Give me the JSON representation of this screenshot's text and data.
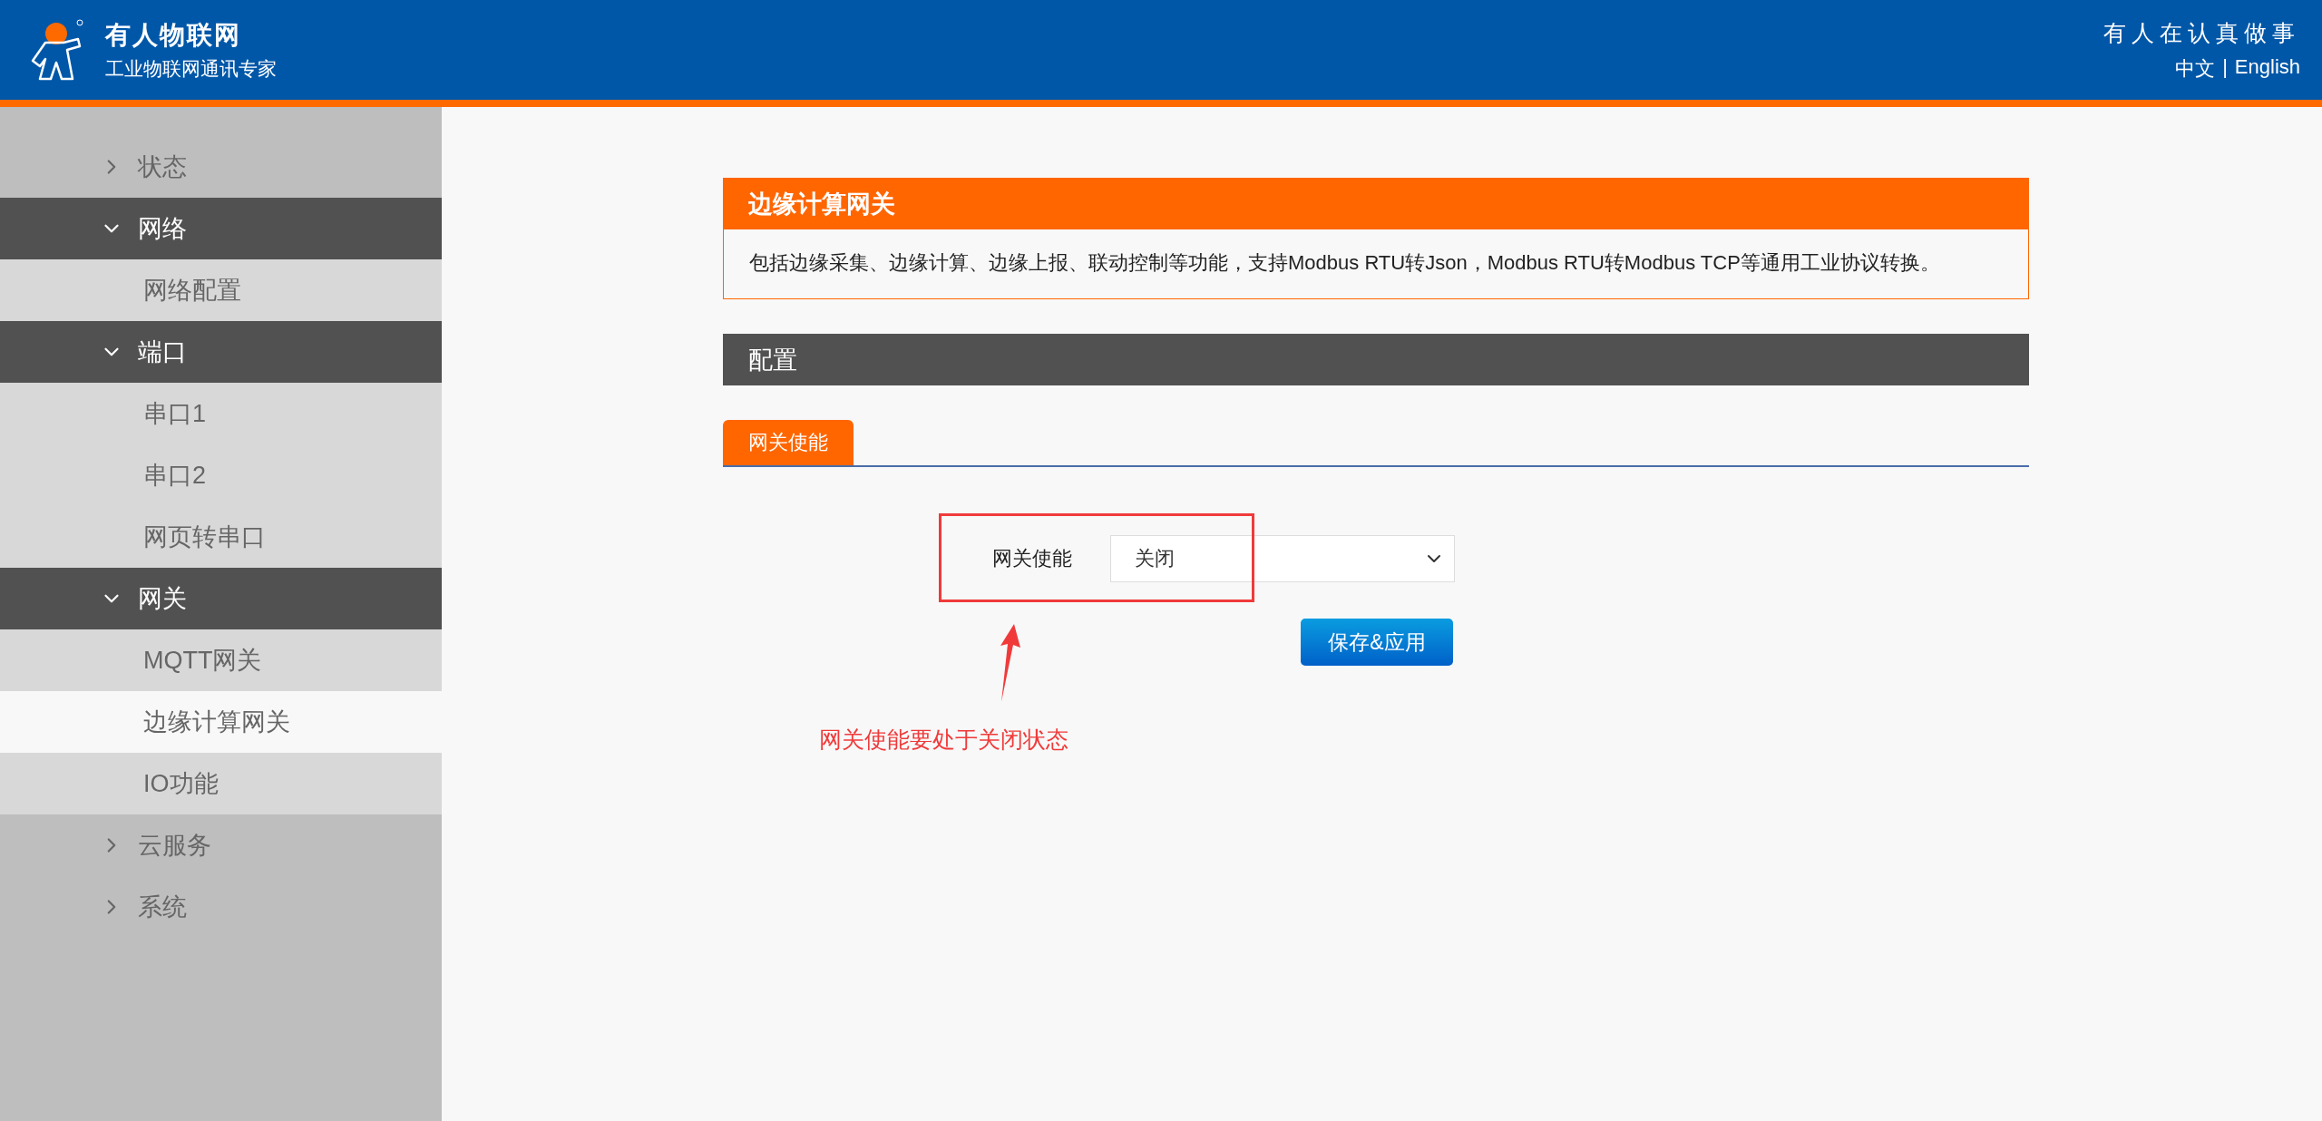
{
  "header": {
    "brand": "有人物联网",
    "tagline": "工业物联网通讯专家",
    "slogan": "有人在认真做事",
    "languages": [
      "中文",
      "English"
    ],
    "language_separator": "|"
  },
  "sidebar": {
    "items": [
      {
        "label": "状态",
        "expanded": false
      },
      {
        "label": "网络",
        "expanded": true,
        "children": [
          {
            "label": "网络配置",
            "selected": false
          }
        ]
      },
      {
        "label": "端口",
        "expanded": true,
        "children": [
          {
            "label": "串口1",
            "selected": false
          },
          {
            "label": "串口2",
            "selected": false
          },
          {
            "label": "网页转串口",
            "selected": false
          }
        ]
      },
      {
        "label": "网关",
        "expanded": true,
        "children": [
          {
            "label": "MQTT网关",
            "selected": false
          },
          {
            "label": "边缘计算网关",
            "selected": true
          },
          {
            "label": "IO功能",
            "selected": false
          }
        ]
      },
      {
        "label": "云服务",
        "expanded": false
      },
      {
        "label": "系统",
        "expanded": false
      }
    ]
  },
  "content": {
    "title": "边缘计算网关",
    "description": "包括边缘采集、边缘计算、边缘上报、联动控制等功能，支持Modbus RTU转Json，Modbus RTU转Modbus TCP等通用工业协议转换。",
    "section_title": "配置",
    "tabs": [
      {
        "label": "网关使能",
        "selected": true
      }
    ],
    "field": {
      "label": "网关使能",
      "value": "关闭"
    },
    "save_button": "保存&应用",
    "annotation": "网关使能要处于关闭状态"
  }
}
